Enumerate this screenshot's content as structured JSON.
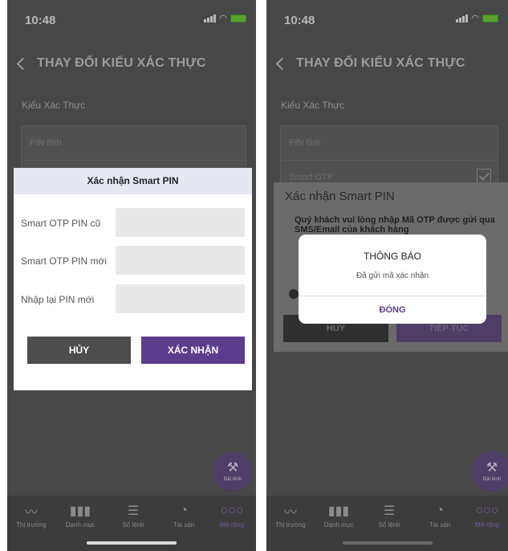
{
  "status": {
    "time": "10:48"
  },
  "nav": {
    "title": "THAY ĐỔI KIỂU XÁC THỰC"
  },
  "auth": {
    "section_label": "Kiểu Xác Thực",
    "options": [
      {
        "label": "PIN tĩnh",
        "checked": false
      },
      {
        "label": "Smart OTP",
        "checked": true
      }
    ]
  },
  "tabs": [
    {
      "label": "Thị trường",
      "icon": "pulse-icon"
    },
    {
      "label": "Danh mục",
      "icon": "bars-icon"
    },
    {
      "label": "Sổ lệnh",
      "icon": "list-icon"
    },
    {
      "label": "Tài sản",
      "icon": "pie-icon"
    },
    {
      "label": "Mở rộng",
      "icon": "more-icon",
      "active": true
    }
  ],
  "fab": {
    "label": "Đặt lệnh",
    "icon": "gavel-icon"
  },
  "smart_pin_modal": {
    "title": "Xác nhận Smart PIN",
    "fields": [
      {
        "label": "Smart OTP PIN cũ",
        "value": ""
      },
      {
        "label": "Smart OTP PIN mới",
        "value": ""
      },
      {
        "label": "Nhập lại PIN mới",
        "value": ""
      }
    ],
    "cancel_label": "HỦY",
    "confirm_label": "XÁC NHẬN"
  },
  "otp_dialog": {
    "title": "Xác nhận Smart PIN",
    "message": "Quý khách vui lòng nhập Mã OTP được gửi qua SMS/Email của khách hàng",
    "cancel_label": "HỦY",
    "next_label": "TIẾP TỤC"
  },
  "notification": {
    "title": "THÔNG BÁO",
    "message": "Đã gửi mã xác nhận",
    "button_label": "ĐÓNG"
  },
  "colors": {
    "accent": "#5b3d8e",
    "overlay": "#474747"
  }
}
